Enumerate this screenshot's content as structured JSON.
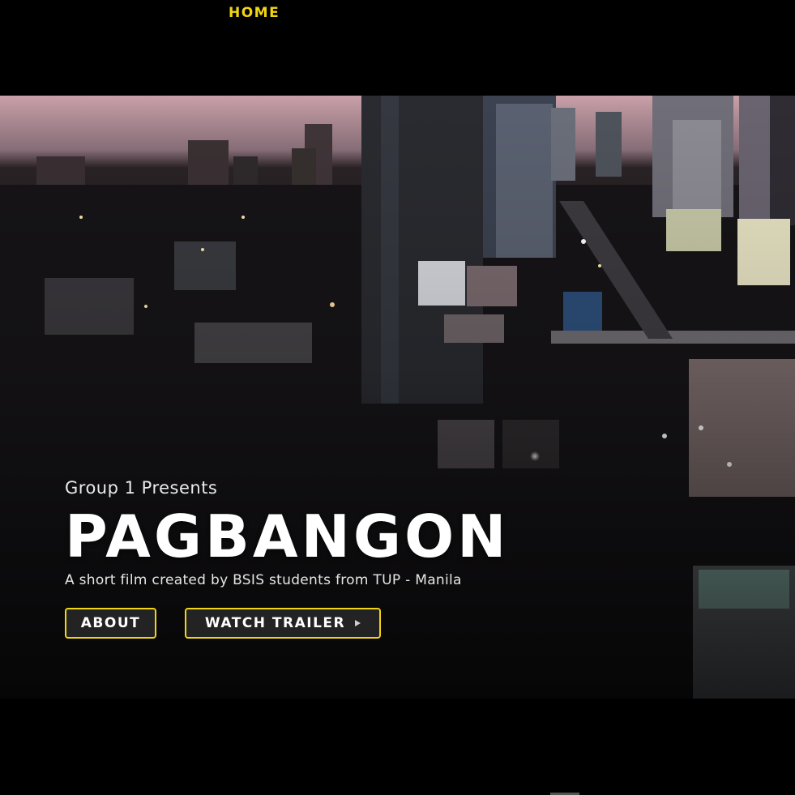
{
  "nav": {
    "home_label": "HOME"
  },
  "hero": {
    "presents": "Group 1 Presents",
    "title": "PAGBANGON",
    "subtitle": "A short film created by BSIS students from TUP - Manila",
    "about_label": "ABOUT",
    "trailer_label": "WATCH TRAILER",
    "trailer_icon": "play-icon"
  },
  "colors": {
    "accent": "#f2d513",
    "background": "#000000",
    "text": "#ffffff"
  }
}
